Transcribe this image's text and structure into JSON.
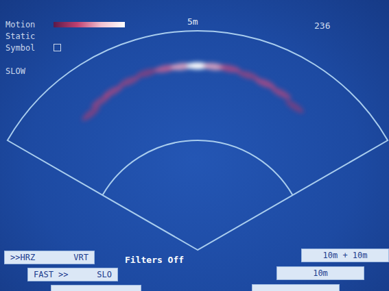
{
  "legend": [
    {
      "label": "Motion",
      "kind": "gradient"
    },
    {
      "label": "Static",
      "kind": "plain"
    },
    {
      "label": "Symbol",
      "kind": "box"
    }
  ],
  "speed": "SLOW",
  "range_label": "5m",
  "counter": "236",
  "status": "Filters Off",
  "sonar": {
    "max_range_m": 10,
    "sector_deg": 120,
    "echoes": [
      {
        "bearing": -38,
        "range": 7.9,
        "level": 0.3
      },
      {
        "bearing": -33,
        "range": 8.1,
        "level": 0.35
      },
      {
        "bearing": -28,
        "range": 8.2,
        "level": 0.4
      },
      {
        "bearing": -22,
        "range": 8.3,
        "level": 0.35
      },
      {
        "bearing": -16,
        "range": 8.4,
        "level": 0.3
      },
      {
        "bearing": -10,
        "range": 8.4,
        "level": 0.55
      },
      {
        "bearing": -5,
        "range": 8.4,
        "level": 0.75
      },
      {
        "bearing": 0,
        "range": 8.4,
        "level": 1.0
      },
      {
        "bearing": 5,
        "range": 8.4,
        "level": 0.75
      },
      {
        "bearing": 10,
        "range": 8.4,
        "level": 0.45
      },
      {
        "bearing": 16,
        "range": 8.3,
        "level": 0.35
      },
      {
        "bearing": 22,
        "range": 8.2,
        "level": 0.45
      },
      {
        "bearing": 28,
        "range": 8.1,
        "level": 0.4
      },
      {
        "bearing": 34,
        "range": 7.9,
        "level": 0.25
      }
    ]
  },
  "left_buttons": [
    {
      "left": ">>HRZ",
      "right": "VRT"
    },
    {
      "left": "FAST >>",
      "right": "SLO"
    },
    {
      "left": "",
      "right": ""
    }
  ],
  "right_buttons": [
    {
      "label": "10m + 10m"
    },
    {
      "label": "10m"
    },
    {
      "label": ""
    }
  ]
}
